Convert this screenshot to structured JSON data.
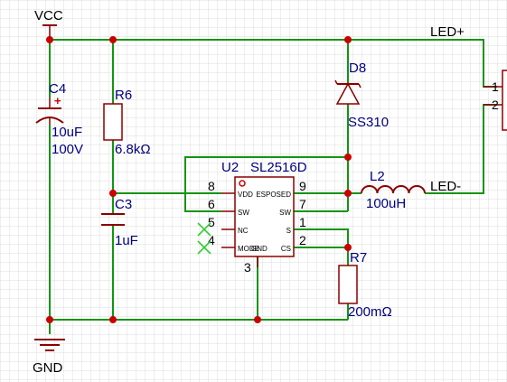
{
  "colors": {
    "background": "#ffffff",
    "grid": "#dcdcdc",
    "wire": "#149414",
    "junction": "#cc0000",
    "component": "#8b0000",
    "net_label": "#000000",
    "designator": "#000080",
    "value": "#000080",
    "pin_number": "#000000",
    "no_connect": "#33cc33"
  },
  "nets": {
    "vcc": "VCC",
    "gnd": "GND",
    "led_plus": "LED+",
    "led_minus": "LED-"
  },
  "components": {
    "c4": {
      "designator": "C4",
      "value1": "10uF",
      "value2": "100V",
      "polarity": "+"
    },
    "r6": {
      "designator": "R6",
      "value": "6.8kΩ"
    },
    "c3": {
      "designator": "C3",
      "value": "1uF"
    },
    "d8": {
      "designator": "D8",
      "value": "SS310"
    },
    "l2": {
      "designator": "L2",
      "value": "100uH"
    },
    "r7": {
      "designator": "R7",
      "value": "200mΩ"
    },
    "u2": {
      "designator": "U2",
      "value": "SL2516D",
      "pins": {
        "p8": {
          "number": "8",
          "name": "VDD"
        },
        "p6": {
          "number": "6",
          "name": "SW"
        },
        "p5": {
          "number": "5",
          "name": "NC"
        },
        "p4": {
          "number": "4",
          "name": "MODE"
        },
        "p9": {
          "number": "9",
          "name": "ESPOSED"
        },
        "p7": {
          "number": "7",
          "name": "SW"
        },
        "p1": {
          "number": "1",
          "name": "S"
        },
        "p2": {
          "number": "2",
          "name": "CS"
        },
        "p3": {
          "number": "3",
          "name": "GND"
        }
      }
    },
    "conn": {
      "pin1": "1",
      "pin2": "2"
    }
  }
}
